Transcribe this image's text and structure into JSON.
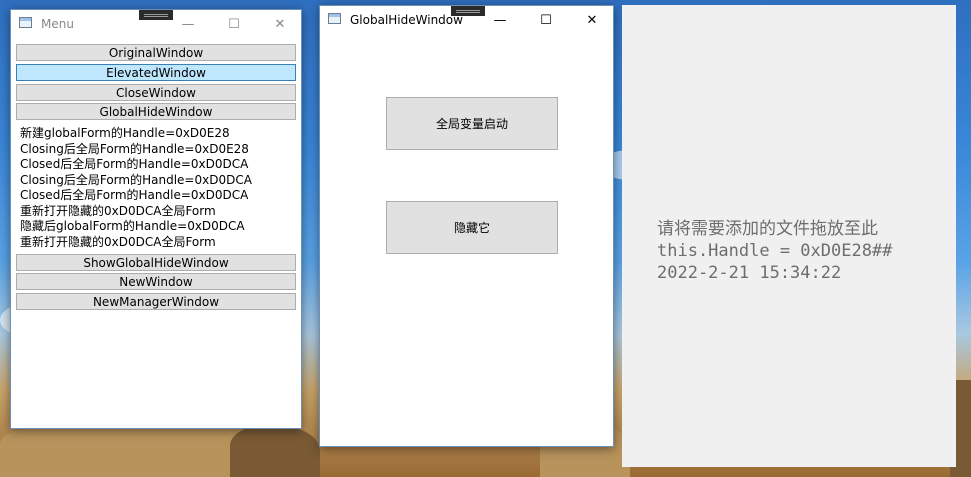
{
  "menu_window": {
    "title": "Menu",
    "controls": {
      "minimize": "—",
      "maximize": "☐",
      "close": "✕"
    },
    "buttons": [
      "OriginalWindow",
      "ElevatedWindow",
      "CloseWindow",
      "GlobalHideWindow"
    ],
    "log": [
      "新建globalForm的Handle=0xD0E28",
      "Closing后全局Form的Handle=0xD0E28",
      "Closed后全局Form的Handle=0xD0DCA",
      "Closing后全局Form的Handle=0xD0DCA",
      "Closed后全局Form的Handle=0xD0DCA",
      "重新打开隐藏的0xD0DCA全局Form",
      "隐藏后globalForm的Handle=0xD0DCA",
      "重新打开隐藏的0xD0DCA全局Form"
    ],
    "buttons_bottom": [
      "ShowGlobalHideWindow",
      "NewWindow",
      "NewManagerWindow"
    ]
  },
  "global_hide_window": {
    "title": "GlobalHideWindow",
    "controls": {
      "minimize": "—",
      "maximize": "☐",
      "close": "✕"
    },
    "start_button": "全局变量启动",
    "hide_button": "隐藏它"
  },
  "drop_panel": {
    "lines": [
      "请将需要添加的文件拖放至此",
      "this.Handle = 0xD0E28##",
      "2022-2-21 15:34:22"
    ]
  }
}
